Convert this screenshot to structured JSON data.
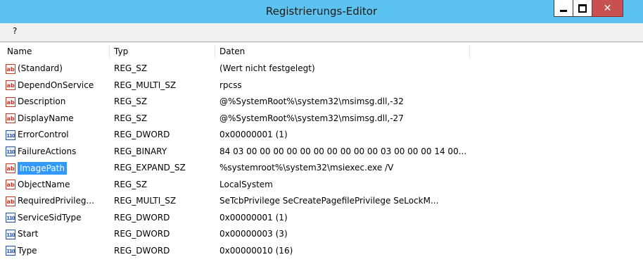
{
  "window": {
    "title": "Registrierungs-Editor"
  },
  "menu": {
    "items": [
      "?"
    ]
  },
  "columns": {
    "name": "Name",
    "type": "Typ",
    "data": "Daten"
  },
  "icons": {
    "string": "ab",
    "binary": "110"
  },
  "colors": {
    "titlebar": "#5cc3f0",
    "close_button": "#c75050",
    "selection": "#3399ff"
  },
  "rows": [
    {
      "name": "(Standard)",
      "type": "REG_SZ",
      "data": "(Wert nicht festgelegt)",
      "icon": "string-value-icon"
    },
    {
      "name": "DependOnService",
      "type": "REG_MULTI_SZ",
      "data": "rpcss",
      "icon": "string-value-icon"
    },
    {
      "name": "Description",
      "type": "REG_SZ",
      "data": "@%SystemRoot%\\system32\\msimsg.dll,-32",
      "icon": "string-value-icon"
    },
    {
      "name": "DisplayName",
      "type": "REG_SZ",
      "data": "@%SystemRoot%\\system32\\msimsg.dll,-27",
      "icon": "string-value-icon"
    },
    {
      "name": "ErrorControl",
      "type": "REG_DWORD",
      "data": "0x00000001 (1)",
      "icon": "binary-value-icon"
    },
    {
      "name": "FailureActions",
      "type": "REG_BINARY",
      "data": "84 03 00 00 00 00 00 00 00 00 00 00 03 00 00 00 14 00...",
      "icon": "binary-value-icon"
    },
    {
      "name": "ImagePath",
      "type": "REG_EXPAND_SZ",
      "data": "%systemroot%\\system32\\msiexec.exe /V",
      "icon": "string-value-icon",
      "selected": true
    },
    {
      "name": "ObjectName",
      "type": "REG_SZ",
      "data": "LocalSystem",
      "icon": "string-value-icon"
    },
    {
      "name": "RequiredPrivileg...",
      "type": "REG_MULTI_SZ",
      "data": "SeTcbPrivilege SeCreatePagefilePrivilege SeLockM...",
      "icon": "string-value-icon"
    },
    {
      "name": "ServiceSidType",
      "type": "REG_DWORD",
      "data": "0x00000001 (1)",
      "icon": "binary-value-icon"
    },
    {
      "name": "Start",
      "type": "REG_DWORD",
      "data": "0x00000003 (3)",
      "icon": "binary-value-icon"
    },
    {
      "name": "Type",
      "type": "REG_DWORD",
      "data": "0x00000010 (16)",
      "icon": "binary-value-icon"
    }
  ]
}
